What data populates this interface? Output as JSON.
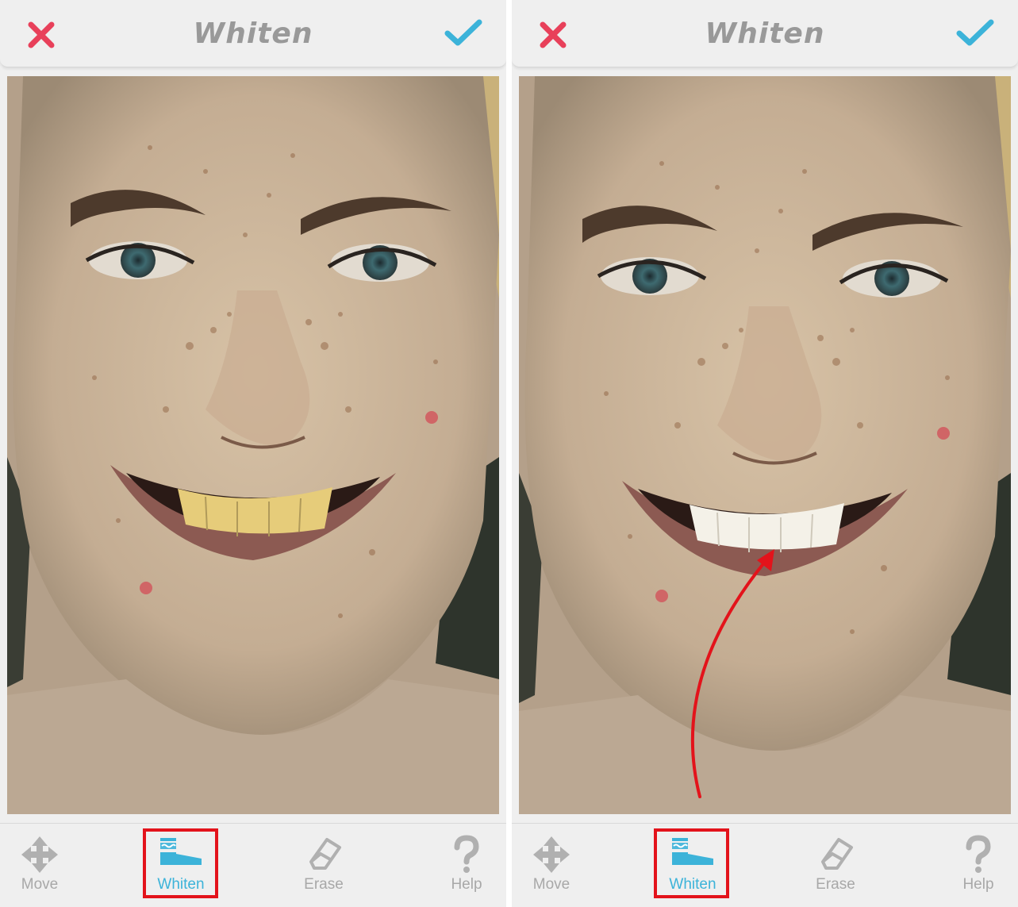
{
  "panels": [
    {
      "id": "before",
      "title": "Whiten",
      "tools": [
        {
          "label": "Move",
          "icon": "move-arrows-icon",
          "active": false
        },
        {
          "label": "Whiten",
          "icon": "toothbrush-icon",
          "active": true
        },
        {
          "label": "Erase",
          "icon": "eraser-icon",
          "active": false
        },
        {
          "label": "Help",
          "icon": "question-mark-icon",
          "active": false
        }
      ],
      "teeth_state": "yellow"
    },
    {
      "id": "after",
      "title": "Whiten",
      "tools": [
        {
          "label": "Move",
          "icon": "move-arrows-icon",
          "active": false
        },
        {
          "label": "Whiten",
          "icon": "toothbrush-icon",
          "active": true
        },
        {
          "label": "Erase",
          "icon": "eraser-icon",
          "active": false
        },
        {
          "label": "Help",
          "icon": "question-mark-icon",
          "active": false
        }
      ],
      "teeth_state": "white"
    }
  ],
  "icons": {
    "cancel": "close-x-icon",
    "confirm": "checkmark-icon"
  },
  "colors": {
    "cancel": "#e8405a",
    "confirm": "#3cb3d9",
    "active_tool": "#3cb3d9",
    "inactive_tool": "#a8a8a8",
    "title": "#999999",
    "highlight_box": "#e3131b",
    "annotation_arrow": "#e3131b"
  }
}
